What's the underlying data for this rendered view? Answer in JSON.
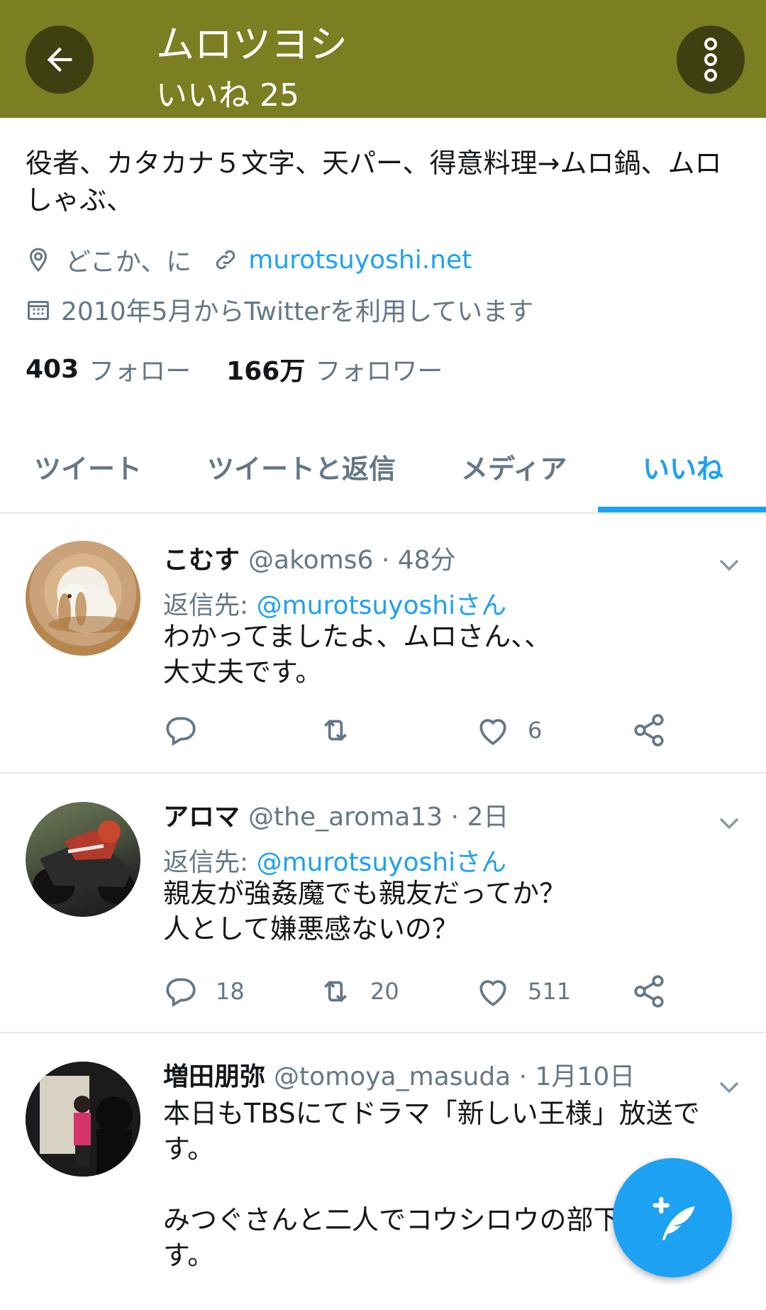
{
  "header": {
    "title": "ムロツヨシ",
    "subtitle": "いいね 25",
    "bg_color": "#7c7e22"
  },
  "profile": {
    "bio": "役者、カタカナ５文字、天パー、得意料理→ムロ鍋、ムロしゃぶ、",
    "location": "どこか、に",
    "website": "murotsuyoshi.net",
    "joined": "2010年5月からTwitterを利用しています",
    "following_count": "403",
    "following_label": "フォロー",
    "followers_count": "166万",
    "followers_label": "フォロワー"
  },
  "tabs": [
    {
      "label": "ツイート"
    },
    {
      "label": "ツイートと返信"
    },
    {
      "label": "メディア"
    },
    {
      "label": "いいね"
    }
  ],
  "active_tab": "いいね",
  "tweets": [
    {
      "name": "こむす",
      "handle": "@akoms6 · 48分",
      "reply_prefix": "返信先: ",
      "reply_to": "@murotsuyoshiさん",
      "text": "わかってましたよ、ムロさん、、\n大丈夫です。",
      "replies": "",
      "retweets": "",
      "likes": "6"
    },
    {
      "name": "アロマ",
      "handle": "@the_aroma13 · 2日",
      "reply_prefix": "返信先: ",
      "reply_to": "@murotsuyoshiさん",
      "text": "親友が強姦魔でも親友だってか？\n人として嫌悪感ないの？",
      "replies": "18",
      "retweets": "20",
      "likes": "511"
    },
    {
      "name": "増田朋弥",
      "handle": "@tomoya_masuda · 1月10日",
      "text": "本日もTBSにてドラマ「新しい王様」放送です。\n\nみつぐさんと二人でコウシロウの部下ります。"
    }
  ],
  "colors": {
    "accent": "#1da1f2",
    "muted": "#657786",
    "text": "#14171a"
  },
  "icons": {
    "back": "arrow-left-icon",
    "menu": "more-vertical-icon",
    "location": "location-pin-icon",
    "link": "link-icon",
    "calendar": "calendar-icon",
    "reply": "reply-icon",
    "retweet": "retweet-icon",
    "like": "heart-icon",
    "share": "share-icon",
    "compose": "compose-tweet-icon"
  }
}
